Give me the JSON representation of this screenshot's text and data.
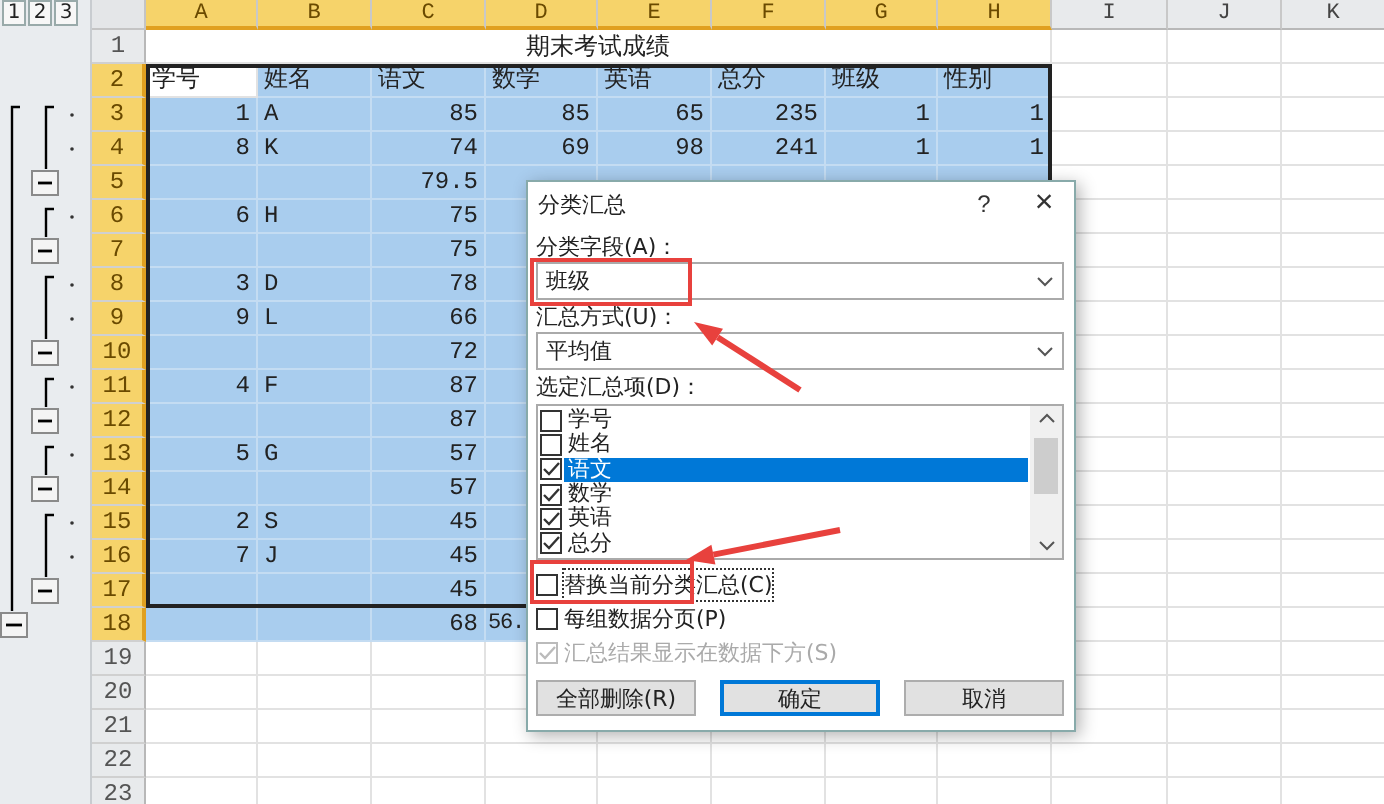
{
  "outline_levels": [
    "1",
    "2",
    "3"
  ],
  "columns": [
    {
      "label": "A",
      "selected": true
    },
    {
      "label": "B",
      "selected": true
    },
    {
      "label": "C",
      "selected": true
    },
    {
      "label": "D",
      "selected": true
    },
    {
      "label": "E",
      "selected": true
    },
    {
      "label": "F",
      "selected": true
    },
    {
      "label": "G",
      "selected": true
    },
    {
      "label": "H",
      "selected": true
    },
    {
      "label": "I",
      "selected": false
    },
    {
      "label": "J",
      "selected": false
    },
    {
      "label": "K",
      "selected": false
    }
  ],
  "rows": [
    {
      "number": "1",
      "kind": "title",
      "selected": false,
      "cells": {
        "A": "期末考试成绩"
      }
    },
    {
      "number": "2",
      "kind": "header",
      "selected": true,
      "cells": {
        "A": {
          "text": "学号",
          "active": true
        },
        "B": "姓名",
        "C": "语文",
        "D": "数学",
        "E": "英语",
        "F": "总分",
        "G": "班级",
        "H": "性别"
      }
    },
    {
      "number": "3",
      "kind": "data",
      "selected": true,
      "outline_dot": true,
      "cells": {
        "A": "1",
        "B": "A",
        "C": "85",
        "D": "85",
        "E": "65",
        "F": "235",
        "G": "1",
        "H": "1"
      }
    },
    {
      "number": "4",
      "kind": "data",
      "selected": true,
      "outline_dot": true,
      "cells": {
        "A": "8",
        "B": "K",
        "C": "74",
        "D": "69",
        "E": "98",
        "F": "241",
        "G": "1",
        "H": "1"
      }
    },
    {
      "number": "5",
      "kind": "data",
      "selected": true,
      "collapse": true,
      "cells": {
        "C": "79.5"
      }
    },
    {
      "number": "6",
      "kind": "data",
      "selected": true,
      "outline_dot": true,
      "cells": {
        "A": "6",
        "B": "H",
        "C": "75"
      }
    },
    {
      "number": "7",
      "kind": "data",
      "selected": true,
      "collapse": true,
      "cells": {
        "C": "75"
      }
    },
    {
      "number": "8",
      "kind": "data",
      "selected": true,
      "outline_dot": true,
      "cells": {
        "A": "3",
        "B": "D",
        "C": "78"
      }
    },
    {
      "number": "9",
      "kind": "data",
      "selected": true,
      "outline_dot": true,
      "cells": {
        "A": "9",
        "B": "L",
        "C": "66"
      }
    },
    {
      "number": "10",
      "kind": "data",
      "selected": true,
      "collapse": true,
      "cells": {
        "C": "72"
      }
    },
    {
      "number": "11",
      "kind": "data",
      "selected": true,
      "outline_dot": true,
      "cells": {
        "A": "4",
        "B": "F",
        "C": "87"
      }
    },
    {
      "number": "12",
      "kind": "data",
      "selected": true,
      "collapse": true,
      "cells": {
        "C": "87"
      }
    },
    {
      "number": "13",
      "kind": "data",
      "selected": true,
      "outline_dot": true,
      "cells": {
        "A": "5",
        "B": "G",
        "C": "57"
      }
    },
    {
      "number": "14",
      "kind": "data",
      "selected": true,
      "collapse": true,
      "cells": {
        "C": "57"
      }
    },
    {
      "number": "15",
      "kind": "data",
      "selected": true,
      "outline_dot": true,
      "cells": {
        "A": "2",
        "B": "S",
        "C": "45"
      }
    },
    {
      "number": "16",
      "kind": "data",
      "selected": true,
      "outline_dot": true,
      "cells": {
        "A": "7",
        "B": "J",
        "C": "45"
      }
    },
    {
      "number": "17",
      "kind": "data",
      "selected": true,
      "collapse": true,
      "cells": {
        "C": "45"
      }
    },
    {
      "number": "18",
      "kind": "data",
      "selected": true,
      "grand_total": true,
      "cells": {
        "C": "68",
        "D": {
          "text": "56.",
          "cut": true
        }
      }
    },
    {
      "number": "19",
      "kind": "data",
      "selected": false,
      "cells": {}
    },
    {
      "number": "20",
      "kind": "data",
      "selected": false,
      "cells": {}
    },
    {
      "number": "21",
      "kind": "data",
      "selected": false,
      "cells": {}
    },
    {
      "number": "22",
      "kind": "data",
      "selected": false,
      "cells": {}
    },
    {
      "number": "23",
      "kind": "data",
      "selected": false,
      "cells": {}
    }
  ],
  "dialog": {
    "title": "分类汇总",
    "help": "?",
    "close": "×",
    "group_field_label": "分类字段(A)：",
    "group_field_value": "班级",
    "function_label": "汇总方式(U)：",
    "function_value": "平均值",
    "items_label": "选定汇总项(D)：",
    "items": [
      {
        "label": "学号",
        "checked": false,
        "selected": false
      },
      {
        "label": "姓名",
        "checked": false,
        "selected": false
      },
      {
        "label": "语文",
        "checked": true,
        "selected": true
      },
      {
        "label": "数学",
        "checked": true,
        "selected": false
      },
      {
        "label": "英语",
        "checked": true,
        "selected": false
      },
      {
        "label": "总分",
        "checked": true,
        "selected": false
      }
    ],
    "options": [
      {
        "label": "替换当前分类汇总(C)",
        "checked": false,
        "disabled": false,
        "focused": true
      },
      {
        "label": "每组数据分页(P)",
        "checked": false,
        "disabled": false,
        "focused": false
      },
      {
        "label": "汇总结果显示在数据下方(S)",
        "checked": true,
        "disabled": true,
        "focused": false
      }
    ],
    "buttons": [
      {
        "label": "全部删除(R)",
        "default": false
      },
      {
        "label": "确定",
        "default": true
      },
      {
        "label": "取消",
        "default": false
      }
    ]
  },
  "annotations": [
    {
      "kind": "frame"
    },
    {
      "kind": "arrow"
    },
    {
      "kind": "frame"
    },
    {
      "kind": "arrow"
    }
  ]
}
